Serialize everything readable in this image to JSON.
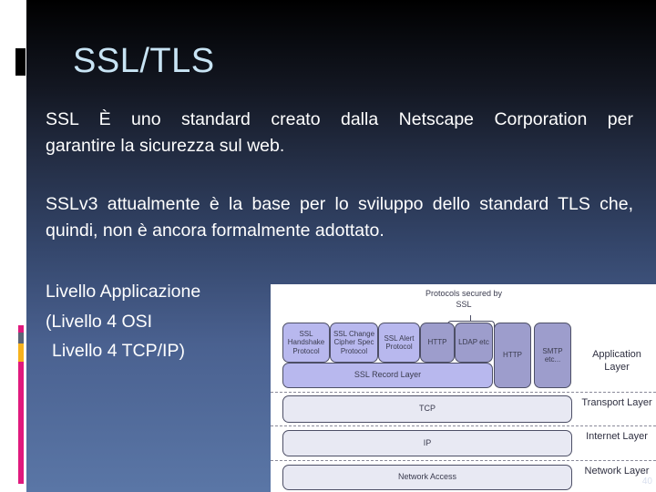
{
  "slide": {
    "title": "SSL/TLS",
    "paragraphs": [
      {
        "line1": "SSL È uno standard creato dalla Netscape Corporation per",
        "line2": "garantire la sicurezza sul web."
      },
      {
        "text": "SSLv3 attualmente è la base per lo sviluppo dello standard TLS che, quindi, non è ancora formalmente adottato."
      }
    ],
    "levels": [
      "Livello Applicazione",
      "(Livello 4 OSI",
      "Livello 4 TCP/IP)"
    ],
    "slide_number": "40"
  },
  "accent_colors": {
    "marker": "#000000",
    "bar_1": "#e0197d",
    "bar_2": "#5b6577",
    "bar_3": "#f6b21c",
    "bar_4": "#e0197d",
    "title_text": "#c8e4f4"
  },
  "diagram": {
    "protocols_label": "Protocols secured by SSL",
    "ssl_protocols": [
      "SSL Handshake Protocol",
      "SSL Change Cipher Spec Protocol",
      "SSL Alert Protocol"
    ],
    "secured_protocols": [
      "HTTP",
      "LDAP etc"
    ],
    "unsecured_protocols": [
      "HTTP",
      "SMTP etc..."
    ],
    "record_layer": "SSL Record Layer",
    "transport": "TCP",
    "internet": "IP",
    "network": "Network Access",
    "layers": {
      "application": "Application Layer",
      "transport": "Transport Layer",
      "internet": "Internet Layer",
      "network": "Network Layer"
    }
  }
}
